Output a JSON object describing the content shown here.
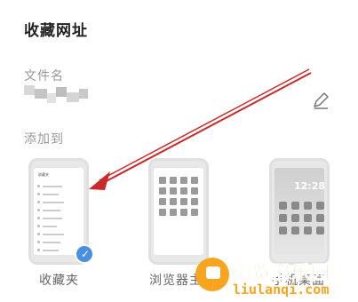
{
  "dialog": {
    "title": "收藏网址",
    "filename_label": "文件名",
    "add_to_label": "添加到"
  },
  "targets": [
    {
      "caption": "收藏夹",
      "selected": true
    },
    {
      "caption": "浏览器主页",
      "selected": false
    },
    {
      "caption": "手机桌面",
      "selected": false
    }
  ],
  "favorites_preview": {
    "header": "收藏夹"
  },
  "home_preview": {
    "clock": "12:28"
  },
  "watermark": {
    "name_cn": "浏览器乐园",
    "domain": "liulanqi.com"
  },
  "colors": {
    "accent_check": "#4a90e2",
    "arrow": "#cc2a2a",
    "watermark": "#f19a1d"
  }
}
